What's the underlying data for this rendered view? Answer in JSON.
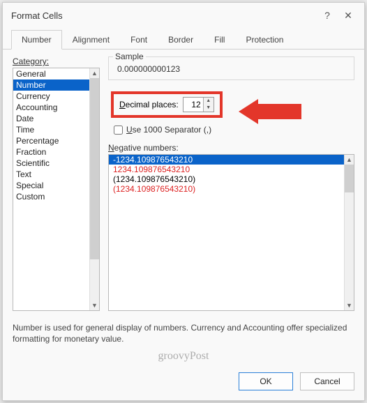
{
  "title": "Format Cells",
  "tabs": [
    "Number",
    "Alignment",
    "Font",
    "Border",
    "Fill",
    "Protection"
  ],
  "activeTab": 0,
  "categoryLabel": "Category:",
  "categories": [
    "General",
    "Number",
    "Currency",
    "Accounting",
    "Date",
    "Time",
    "Percentage",
    "Fraction",
    "Scientific",
    "Text",
    "Special",
    "Custom"
  ],
  "selectedCategory": 1,
  "sampleLabel": "Sample",
  "sampleValue": "0.000000000123",
  "decimalLabel": "Decimal places:",
  "decimalValue": "12",
  "separatorLabel": "Use 1000 Separator (,)",
  "separatorChecked": false,
  "negativeLabel": "Negative numbers:",
  "negativeOptions": [
    {
      "text": "-1234.109876543210",
      "red": false,
      "selected": true
    },
    {
      "text": "1234.109876543210",
      "red": true,
      "selected": false
    },
    {
      "text": "(1234.109876543210)",
      "red": false,
      "selected": false
    },
    {
      "text": "(1234.109876543210)",
      "red": true,
      "selected": false
    }
  ],
  "description": "Number is used for general display of numbers.  Currency and Accounting offer specialized formatting for monetary value.",
  "watermark": "groovyPost",
  "okLabel": "OK",
  "cancelLabel": "Cancel",
  "helpGlyph": "?",
  "closeGlyph": "✕"
}
